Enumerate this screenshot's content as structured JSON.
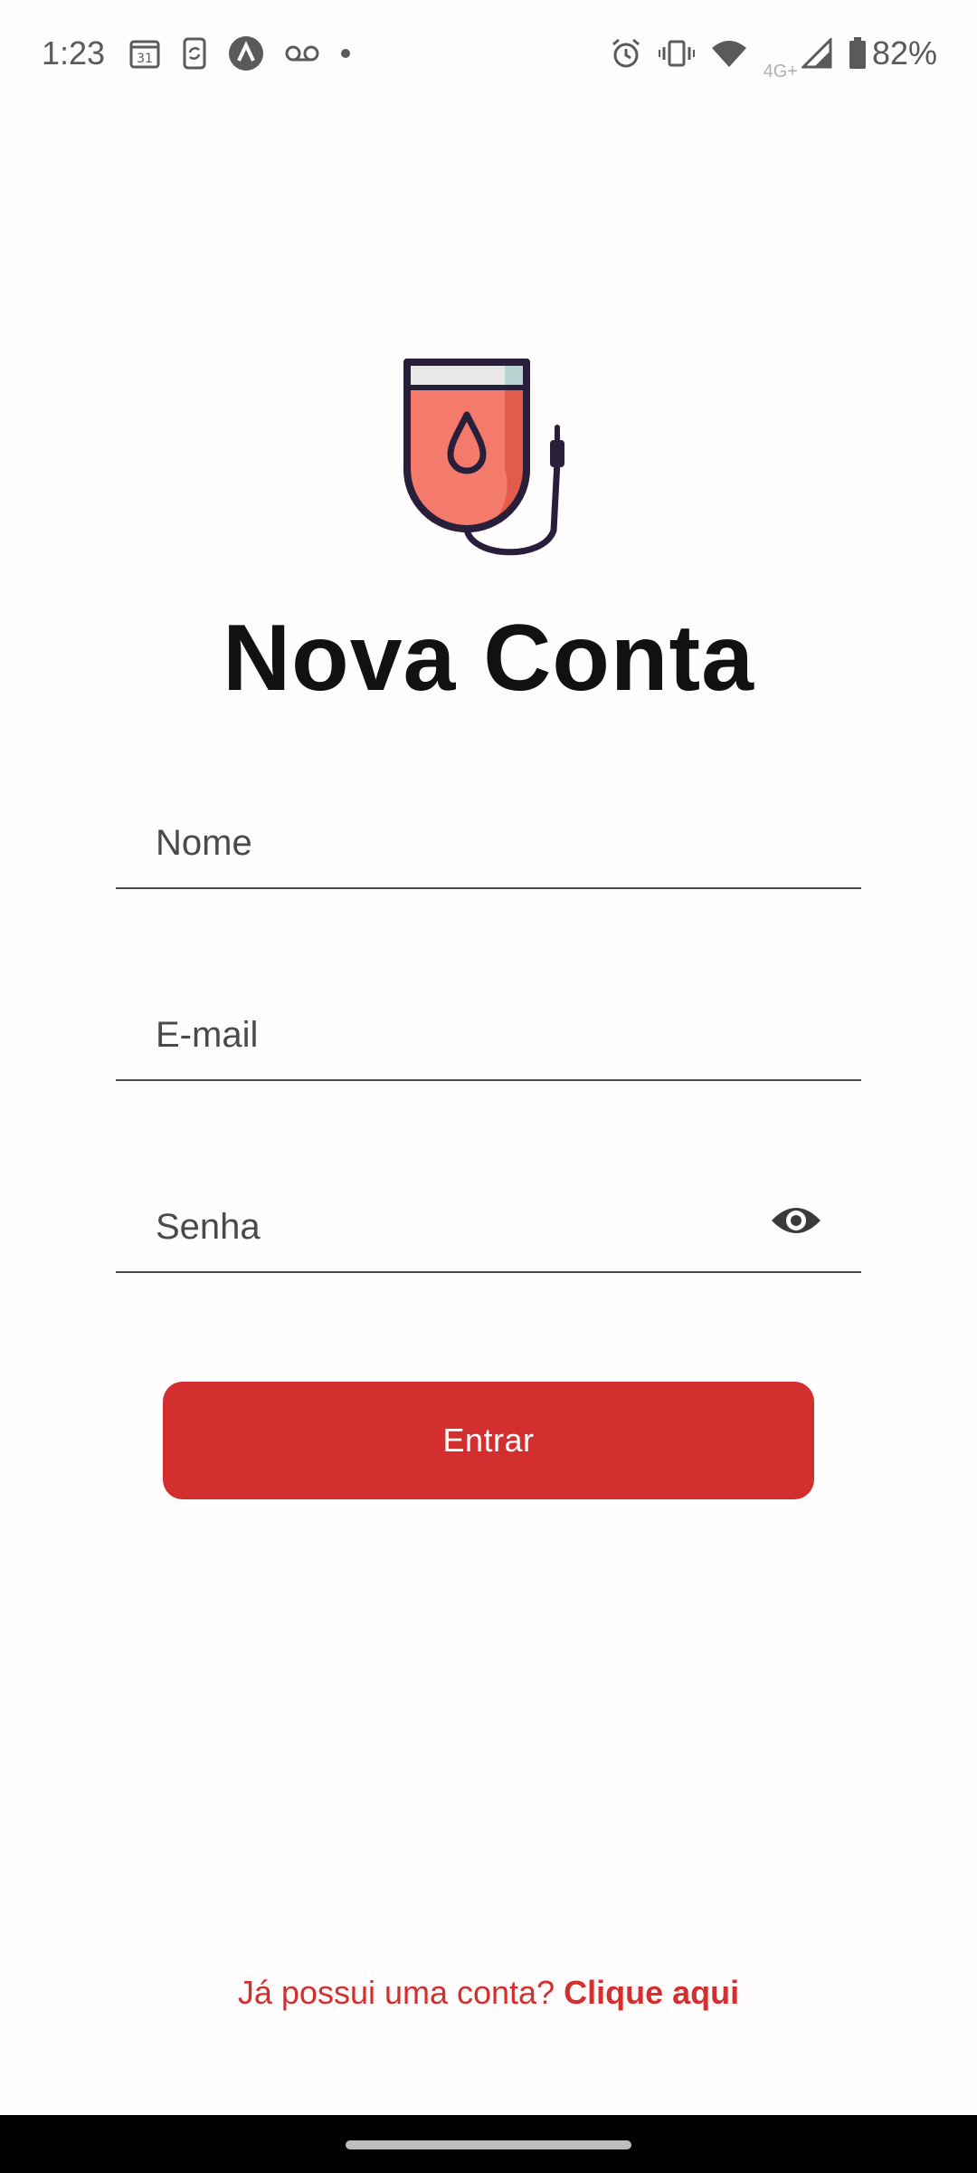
{
  "status_bar": {
    "time": "1:23",
    "calendar_day": "31",
    "network_type": "4G+",
    "battery": "82%"
  },
  "icons": {
    "calendar": "calendar-icon",
    "phone_sync": "phone-sync-icon",
    "app": "app-icon",
    "voicemail": "voicemail-icon",
    "alarm": "alarm-icon",
    "vibrate": "vibrate-icon",
    "wifi": "wifi-icon",
    "signal": "signal-icon",
    "battery": "battery-icon",
    "logo": "blood-bag-icon",
    "eye": "eye-icon"
  },
  "screen": {
    "title": "Nova Conta"
  },
  "form": {
    "name_placeholder": "Nome",
    "email_placeholder": "E-mail",
    "password_placeholder": "Senha",
    "submit_label": "Entrar"
  },
  "footer": {
    "prompt": "Já possui uma conta?",
    "link": "Clique aqui"
  },
  "colors": {
    "primary": "#d32f2f",
    "text": "#111111"
  }
}
